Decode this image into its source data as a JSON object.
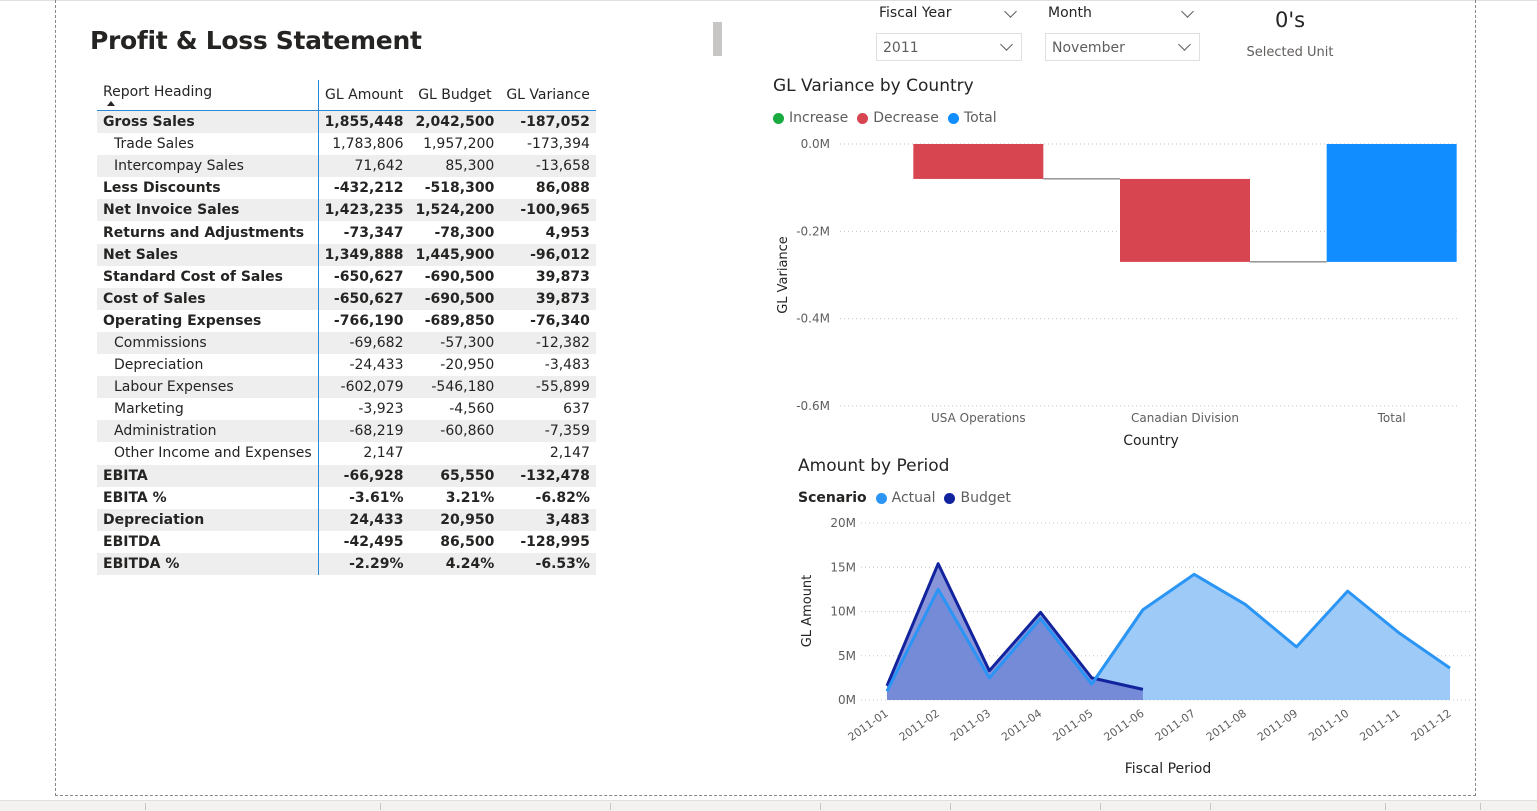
{
  "report_title": "Profit & Loss Statement",
  "table": {
    "columns": [
      "Report Heading",
      "GL Amount",
      "GL Budget",
      "GL Variance"
    ],
    "rows": [
      {
        "label": "Gross Sales",
        "amount": "1,855,448",
        "budget": "2,042,500",
        "variance": "-187,052",
        "bold": true,
        "indent": false
      },
      {
        "label": "Trade Sales",
        "amount": "1,783,806",
        "budget": "1,957,200",
        "variance": "-173,394",
        "bold": false,
        "indent": true
      },
      {
        "label": "Intercompay Sales",
        "amount": "71,642",
        "budget": "85,300",
        "variance": "-13,658",
        "bold": false,
        "indent": true
      },
      {
        "label": "Less Discounts",
        "amount": "-432,212",
        "budget": "-518,300",
        "variance": "86,088",
        "bold": true,
        "indent": false
      },
      {
        "label": "Net Invoice Sales",
        "amount": "1,423,235",
        "budget": "1,524,200",
        "variance": "-100,965",
        "bold": true,
        "indent": false
      },
      {
        "label": "Returns and Adjustments",
        "amount": "-73,347",
        "budget": "-78,300",
        "variance": "4,953",
        "bold": true,
        "indent": false
      },
      {
        "label": "Net Sales",
        "amount": "1,349,888",
        "budget": "1,445,900",
        "variance": "-96,012",
        "bold": true,
        "indent": false
      },
      {
        "label": "Standard Cost of Sales",
        "amount": "-650,627",
        "budget": "-690,500",
        "variance": "39,873",
        "bold": true,
        "indent": false
      },
      {
        "label": "Cost of Sales",
        "amount": "-650,627",
        "budget": "-690,500",
        "variance": "39,873",
        "bold": true,
        "indent": false
      },
      {
        "label": "Operating Expenses",
        "amount": "-766,190",
        "budget": "-689,850",
        "variance": "-76,340",
        "bold": true,
        "indent": false
      },
      {
        "label": "Commissions",
        "amount": "-69,682",
        "budget": "-57,300",
        "variance": "-12,382",
        "bold": false,
        "indent": true
      },
      {
        "label": "Depreciation",
        "amount": "-24,433",
        "budget": "-20,950",
        "variance": "-3,483",
        "bold": false,
        "indent": true
      },
      {
        "label": "Labour Expenses",
        "amount": "-602,079",
        "budget": "-546,180",
        "variance": "-55,899",
        "bold": false,
        "indent": true
      },
      {
        "label": "Marketing",
        "amount": "-3,923",
        "budget": "-4,560",
        "variance": "637",
        "bold": false,
        "indent": true
      },
      {
        "label": "Administration",
        "amount": "-68,219",
        "budget": "-60,860",
        "variance": "-7,359",
        "bold": false,
        "indent": true
      },
      {
        "label": "Other Income and Expenses",
        "amount": "2,147",
        "budget": "",
        "variance": "2,147",
        "bold": false,
        "indent": true
      },
      {
        "label": "EBITA",
        "amount": "-66,928",
        "budget": "65,550",
        "variance": "-132,478",
        "bold": true,
        "indent": false
      },
      {
        "label": "EBITA %",
        "amount": "-3.61%",
        "budget": "3.21%",
        "variance": "-6.82%",
        "bold": true,
        "indent": false
      },
      {
        "label": "Depreciation",
        "amount": "24,433",
        "budget": "20,950",
        "variance": "3,483",
        "bold": true,
        "indent": false
      },
      {
        "label": "EBITDA",
        "amount": "-42,495",
        "budget": "86,500",
        "variance": "-128,995",
        "bold": true,
        "indent": false
      },
      {
        "label": "EBITDA %",
        "amount": "-2.29%",
        "budget": "4.24%",
        "variance": "-6.53%",
        "bold": true,
        "indent": false
      }
    ]
  },
  "slicers": {
    "fiscal_year": {
      "label": "Fiscal Year",
      "value": "2011"
    },
    "month": {
      "label": "Month",
      "value": "November"
    }
  },
  "card": {
    "value": "0's",
    "label": "Selected Unit"
  },
  "colors": {
    "increase": "#1aab40",
    "decrease": "#d64550",
    "total": "#118dff",
    "actual": "#2b95f5",
    "actual_fill": "#9ecaf7",
    "budget": "#12239e",
    "budget_fill": "#6a7bd0"
  },
  "chart_data": [
    {
      "type": "bar",
      "subtype": "waterfall",
      "title": "GL Variance by Country",
      "legend": [
        "Increase",
        "Decrease",
        "Total"
      ],
      "categories": [
        "USA Operations",
        "Canadian Division",
        "Total"
      ],
      "values": [
        -0.08,
        -0.19,
        -0.27
      ],
      "kinds": [
        "decrease",
        "decrease",
        "total"
      ],
      "xlabel": "Country",
      "ylabel": "GL Variance",
      "yticks": [
        "0.0M",
        "-0.2M",
        "-0.4M",
        "-0.6M"
      ],
      "ylim": [
        -0.6,
        0
      ],
      "unit": "M",
      "grid": true,
      "legend_position": "top-left"
    },
    {
      "type": "area",
      "title": "Amount by Period",
      "legend_title": "Scenario",
      "x": [
        "2011-01",
        "2011-02",
        "2011-03",
        "2011-04",
        "2011-05",
        "2011-06",
        "2011-07",
        "2011-08",
        "2011-09",
        "2011-10",
        "2011-11",
        "2011-12"
      ],
      "series": [
        {
          "name": "Actual",
          "values": [
            1.0,
            12.5,
            2.5,
            9.2,
            1.8,
            10.2,
            14.2,
            10.8,
            6.0,
            12.3,
            7.6,
            3.6
          ]
        },
        {
          "name": "Budget",
          "values": [
            1.6,
            15.4,
            3.3,
            9.9,
            2.5,
            1.2,
            null,
            null,
            null,
            null,
            null,
            null
          ]
        }
      ],
      "xlabel": "Fiscal Period",
      "ylabel": "GL Amount",
      "yticks": [
        "20M",
        "15M",
        "10M",
        "5M",
        "0M"
      ],
      "ylim": [
        0,
        20
      ],
      "unit": "M",
      "grid": true,
      "legend_position": "top-left"
    }
  ]
}
